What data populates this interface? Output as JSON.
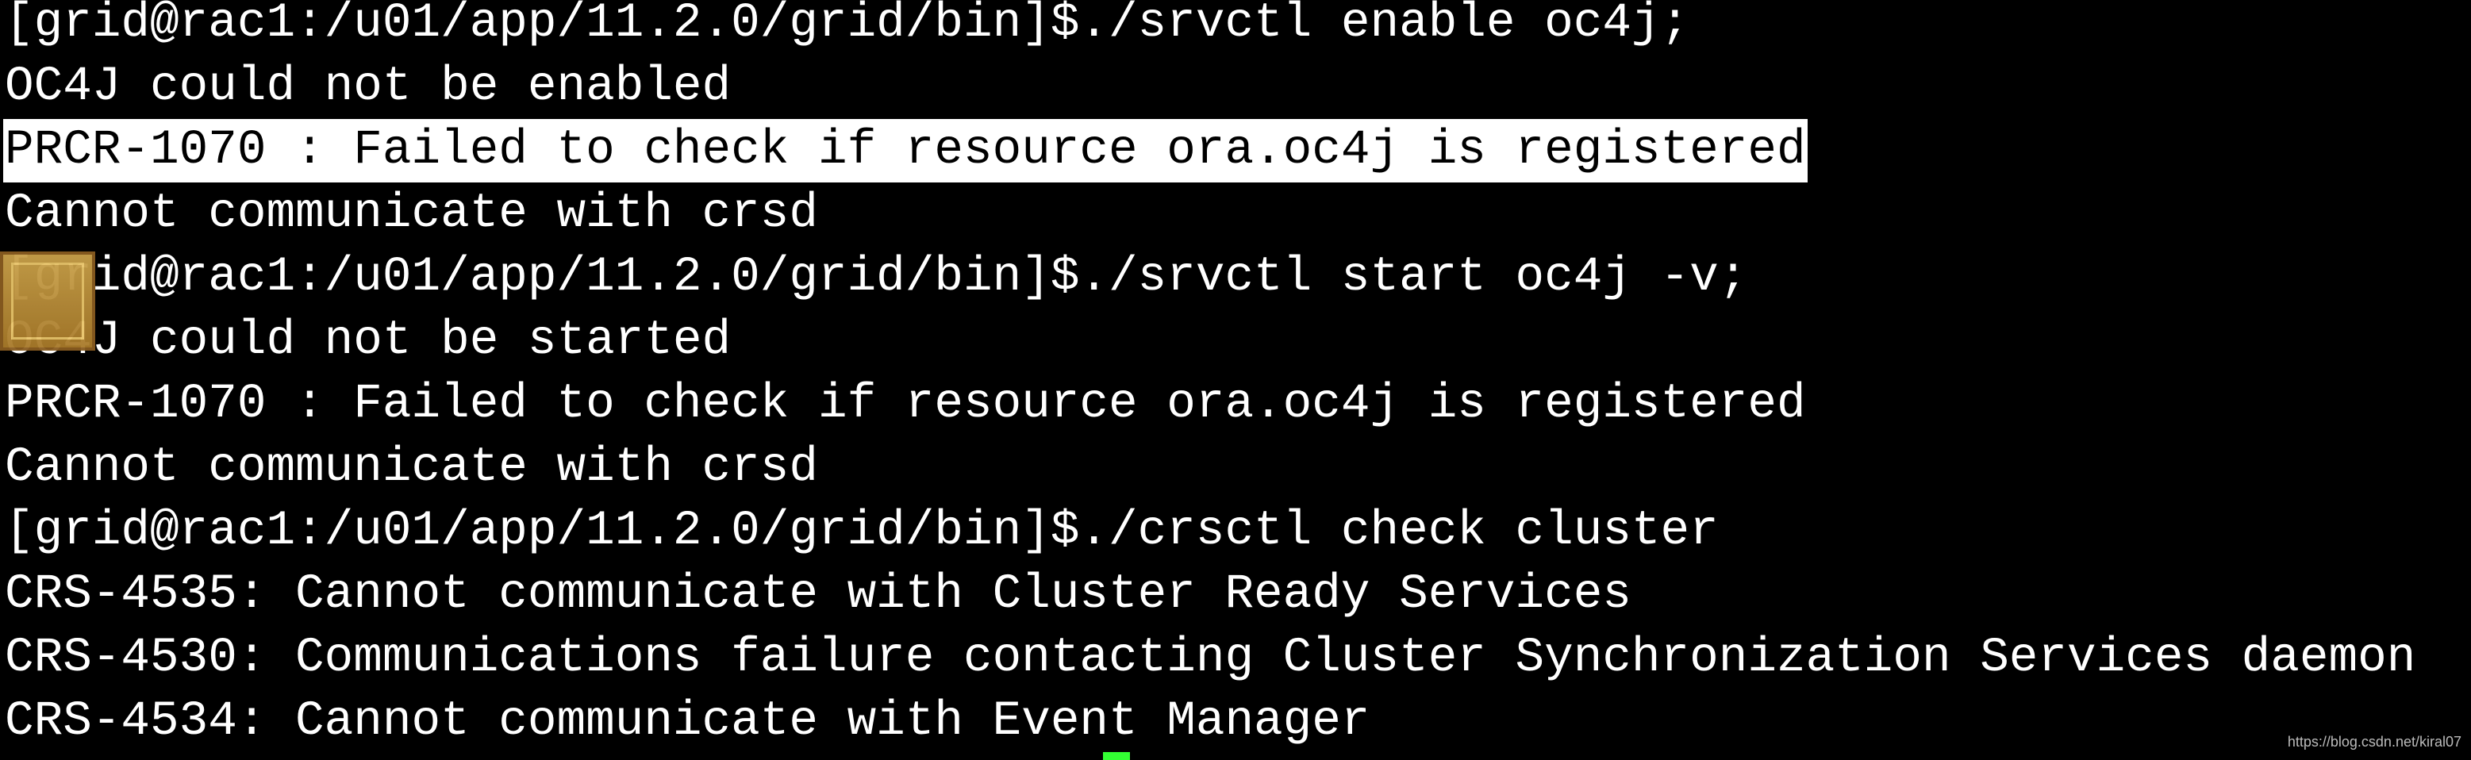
{
  "terminal": {
    "lines": [
      "[grid@rac1:/u01/app/11.2.0/grid/bin]$./srvctl enable oc4j;",
      "OC4J could not be enabled",
      "PRCR-1070 : Failed to check if resource ora.oc4j is registered",
      "Cannot communicate with crsd",
      "[grid@rac1:/u01/app/11.2.0/grid/bin]$./srvctl start oc4j -v;",
      "OC4J could not be started",
      "PRCR-1070 : Failed to check if resource ora.oc4j is registered",
      "Cannot communicate with crsd",
      "[grid@rac1:/u01/app/11.2.0/grid/bin]$./crsctl check cluster",
      "CRS-4535: Cannot communicate with Cluster Ready Services",
      "CRS-4530: Communications failure contacting Cluster Synchronization Services daemon",
      "CRS-4534: Cannot communicate with Event Manager"
    ],
    "highlighted_line_index": 2,
    "cursor_color": "#33ff33",
    "background": "#000000",
    "foreground": "#ffffff"
  },
  "overlay_icon": "app-icon",
  "watermark": "https://blog.csdn.net/kiral07"
}
